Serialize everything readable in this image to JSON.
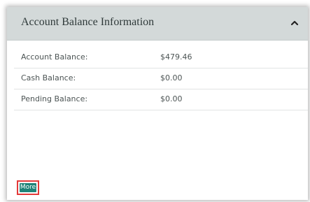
{
  "panel": {
    "title": "Account Balance Information",
    "toggle_icon": "chevron-up-icon"
  },
  "balances": [
    {
      "label": "Account Balance:",
      "value": "$479.46"
    },
    {
      "label": "Cash Balance:",
      "value": "$0.00"
    },
    {
      "label": "Pending Balance:",
      "value": "$0.00"
    }
  ],
  "actions": {
    "more_label": "More"
  },
  "colors": {
    "header_bg": "#d3d9d9",
    "button_bg": "#1f8378",
    "highlight": "#e33a3a"
  }
}
